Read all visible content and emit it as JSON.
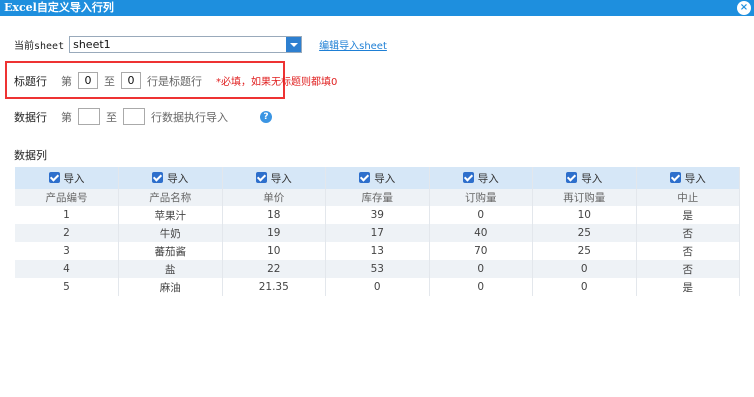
{
  "dialog": {
    "title": "Excel自定义导入行列",
    "close_icon": "×"
  },
  "sheet": {
    "label": "当前sheet",
    "value": "sheet1",
    "edit_link": "编辑导入sheet"
  },
  "title_row": {
    "label": "标题行",
    "di": "第",
    "from": "0",
    "zhi": "至",
    "to": "0",
    "suffix": "行是标题行",
    "required_note": "*必填，如果无标题则都填0"
  },
  "data_row": {
    "label": "数据行",
    "di": "第",
    "from": "",
    "zhi": "至",
    "to": "",
    "suffix": "行数据执行导入",
    "help": "?"
  },
  "data_columns": {
    "label": "数据列",
    "import_label": "导入",
    "headers": [
      "产品编号",
      "产品名称",
      "单价",
      "库存量",
      "订购量",
      "再订购量",
      "中止"
    ],
    "rows": [
      [
        "1",
        "苹果汁",
        "18",
        "39",
        "0",
        "10",
        "是"
      ],
      [
        "2",
        "牛奶",
        "19",
        "17",
        "40",
        "25",
        "否"
      ],
      [
        "3",
        "蕃茄酱",
        "10",
        "13",
        "70",
        "25",
        "否"
      ],
      [
        "4",
        "盐",
        "22",
        "53",
        "0",
        "0",
        "否"
      ],
      [
        "5",
        "麻油",
        "21.35",
        "0",
        "0",
        "0",
        "是"
      ]
    ]
  }
}
